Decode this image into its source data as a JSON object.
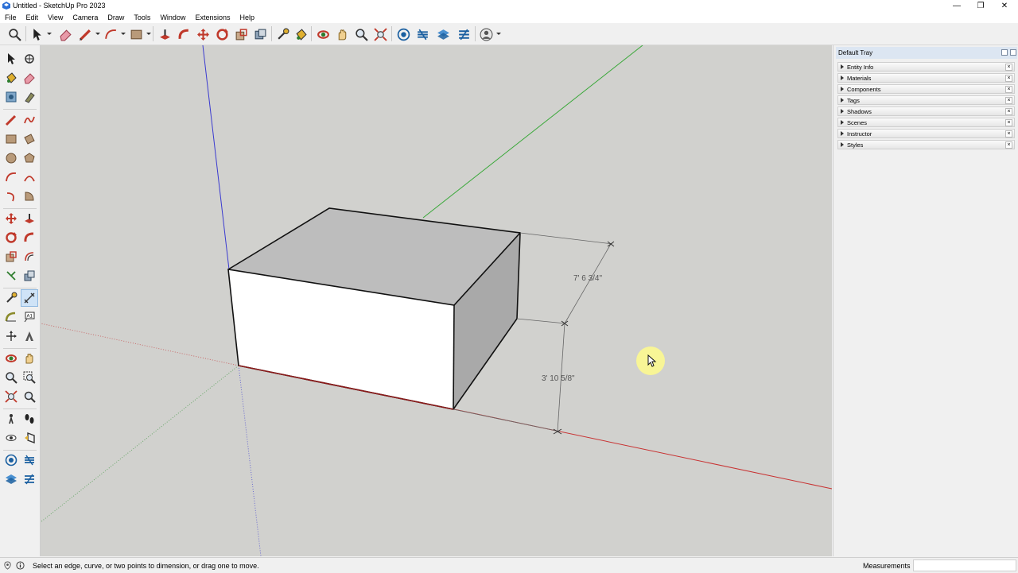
{
  "window": {
    "title": "Untitled - SketchUp Pro 2023",
    "minimize_glyph": "—",
    "restore_glyph": "❐",
    "close_glyph": "✕"
  },
  "menu": [
    "File",
    "Edit",
    "View",
    "Camera",
    "Draw",
    "Tools",
    "Window",
    "Extensions",
    "Help"
  ],
  "toolbar_icons": [
    "search-tool",
    "select",
    "eraser",
    "line",
    "arc",
    "rectangle",
    "push-pull",
    "move",
    "rotate",
    "scale",
    "offset",
    "tape-measure",
    "paint-bucket",
    "orbit",
    "pan",
    "zoom",
    "zoom-extents",
    "warehouse",
    "extension-warehouse",
    "layout",
    "style-builder",
    "account"
  ],
  "viewport": {
    "dimension_depth": "7' 6 3/4\"",
    "dimension_height": "3' 10 5/8\"",
    "colors": {
      "background": "#d1d1ce",
      "red_axis": "#c83232",
      "green_axis": "#3aa83a",
      "blue_axis": "#3a3ad0",
      "front_face": "#ffffff",
      "top_face": "#bdbdbd",
      "side_face": "#a9a9a9"
    }
  },
  "tray": {
    "title": "Default Tray",
    "panels": [
      "Entity Info",
      "Materials",
      "Components",
      "Tags",
      "Shadows",
      "Scenes",
      "Instructor",
      "Styles"
    ],
    "close_glyph": "×"
  },
  "status": {
    "hint": "Select an edge, curve, or two points to dimension, or drag one to move.",
    "measurements_label": "Measurements"
  }
}
